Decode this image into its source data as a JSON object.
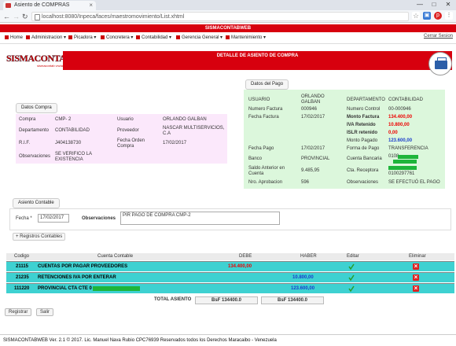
{
  "browser": {
    "tab_title": "Asiento de COMPRAS",
    "tab_close": "×",
    "url": "localhost:8080/Inpeca/faces/maestromovimiento/List.xhtml",
    "min": "—",
    "max": "□",
    "close": "✕"
  },
  "app": {
    "title": "SISMACONTABWEB",
    "logout": "Cerrar Sesion",
    "menu": [
      {
        "label": "Home",
        "icon": "home-icon"
      },
      {
        "label": "Administracion ▾",
        "icon": "admin-icon"
      },
      {
        "label": "Picadora ▾",
        "icon": "grinder-icon"
      },
      {
        "label": "Concretera ▾",
        "icon": "mixer-icon"
      },
      {
        "label": "Contabilidad ▾",
        "icon": "accounting-icon"
      },
      {
        "label": "Gerencia General ▾",
        "icon": "management-icon"
      },
      {
        "label": "Mantenimiento ▾",
        "icon": "maintenance-icon"
      }
    ]
  },
  "logo": {
    "big": "SISMACONTAB",
    "small": "sismacontab vnzla"
  },
  "banner": {
    "title": "DETALLE DE ASIENTO DE COMPRA"
  },
  "compra": {
    "header": "Datos Compra",
    "compra_label": "Compra",
    "compra_value": "CMP- 2",
    "usuario_label": "Usuario",
    "usuario_value": "ORLANDO GALBAN",
    "departamento_label": "Departamento",
    "departamento_value": "CONTABILIDAD",
    "proveedor_label": "Proveedor",
    "proveedor_value": "NASCAR MULTISERVICIOS, C.A",
    "rif_label": "R.I.F.",
    "rif_value": "J404138730",
    "fecha_orden_label": "Fecha Orden Compra",
    "fecha_orden_value": "17/02/2017",
    "observaciones_label": "Observaciones",
    "observaciones_value": "SE VERIFICO LA EXISTENCIA"
  },
  "pago": {
    "header": "Datos del Pago",
    "usuario_label": "USUARIO",
    "usuario_value": "ORLANDO GALBAN",
    "departamento_label": "DEPARTAMENTO",
    "departamento_value": "CONTABILIDAD",
    "numero_factura_label": "Numero Factura",
    "numero_factura_value": "000946",
    "numero_control_label": "Numero Control",
    "numero_control_value": "00-000946",
    "fecha_factura_label": "Fecha Factura",
    "fecha_factura_value": "17/02/2017",
    "monto_factura_label": "Monto Factura",
    "monto_factura_value": "134.400,00",
    "iva_label": "IVA Retenido",
    "iva_value": "10.800,00",
    "islr_label": "ISLR retenido",
    "islr_value": "0,00",
    "monto_pagado_label": "Monto Pagado",
    "monto_pagado_value": "123.600,00",
    "fecha_pago_label": "Fecha Pago",
    "fecha_pago_value": "17/02/2017",
    "forma_pago_label": "Forma de Pago",
    "forma_pago_value": "TRANSFERENCIA",
    "banco_label": "Banco",
    "banco_value": "PROVINCIAL",
    "cuenta_bancaria_label": "Cuenta Bancaria",
    "cuenta_bancaria_value": "0108",
    "saldo_label": "Saldo Anterior en Cuenta",
    "saldo_value": "9.485,95",
    "cta_receptora_label": "Cta. Receptora",
    "cta_receptora_value": "0100297761",
    "nro_aprobacion_label": "Nro. Aprobacion",
    "nro_aprobacion_value": "596",
    "observaciones_label": "Observaciones",
    "observaciones_value": "SE EFECTUÓ EL PAGO"
  },
  "asiento": {
    "header": "Asiento Contable",
    "fecha_label": "Fecha *",
    "fecha_value": "17/02/2017",
    "observaciones_label": "Observaciones",
    "observaciones_value": "PIR PAGO DE COMPRA CMP-2",
    "registros_button": "+ Registros Contables"
  },
  "table": {
    "headers": {
      "codigo": "Codigo",
      "cuenta": "Cuenta Contable",
      "debe": "DEBE",
      "haber": "HABER",
      "editar": "Editar",
      "eliminar": "Eliminar"
    },
    "rows": [
      {
        "codigo": "21115",
        "cuenta": "CUENTAS POR PAGAR PROVEEDORES",
        "debe": "134.400,00",
        "haber": ""
      },
      {
        "codigo": "21235",
        "cuenta": "RETENCIONES IVA POR ENTERAR",
        "debe": "",
        "haber": "10.800,00"
      },
      {
        "codigo": "111220",
        "cuenta": "PROVINCIAL CTA CTE 0",
        "debe": "",
        "haber": "123.600,00"
      }
    ],
    "total_label": "TOTAL ASIENTO",
    "total_debe": "BsF 134400.0",
    "total_haber": "BsF 134400.0"
  },
  "buttons": {
    "registrar": "Registrar",
    "salir": "Salir"
  },
  "footer": "SISMACONTABWEB Ver. 2.1 © 2017. Lic. Manuel Nava Rubio CPC76939 Reservados todos los Derechos Maracaibo - Venezuela"
}
